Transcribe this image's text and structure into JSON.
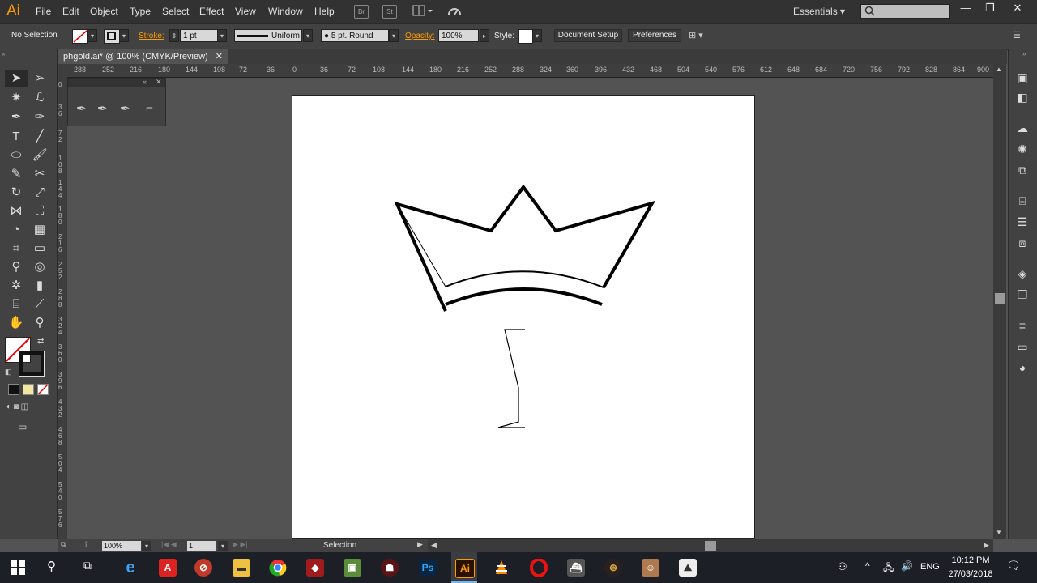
{
  "app": {
    "logo": "Ai",
    "document_tab": "phgold.ai* @ 100% (CMYK/Preview)",
    "workspace": "Essentials"
  },
  "menu": [
    "File",
    "Edit",
    "Object",
    "Type",
    "Select",
    "Effect",
    "View",
    "Window",
    "Help"
  ],
  "menu_icons": [
    "Br",
    "St",
    "arrange-documents-icon",
    "gpu-performance-icon"
  ],
  "control_bar": {
    "selection": "No Selection",
    "stroke_label": "Stroke:",
    "stroke_weight": "1 pt",
    "stroke_profile": "Uniform",
    "brush": "5 pt. Round",
    "opacity_label": "Opacity:",
    "opacity": "100%",
    "style_label": "Style:",
    "document_setup": "Document Setup",
    "preferences": "Preferences"
  },
  "ruler_h": [
    "288",
    "252",
    "216",
    "180",
    "144",
    "108",
    "72",
    "36",
    "0",
    "36",
    "72",
    "108",
    "144",
    "180",
    "216",
    "252",
    "288",
    "324",
    "360",
    "396",
    "432",
    "468",
    "504",
    "540",
    "576",
    "612",
    "648",
    "684",
    "720",
    "756",
    "792",
    "828",
    "864",
    "900"
  ],
  "ruler_v": [
    "0",
    "3 6",
    "7 2",
    "1 0 8",
    "1 4 4",
    "1 8 0",
    "2 1 6",
    "2 5 2",
    "2 8 8",
    "3 2 4",
    "3 6 0",
    "3 9 6",
    "4 3 2",
    "4 6 8",
    "5 0 4",
    "5 4 0",
    "5 7 6"
  ],
  "status": {
    "zoom": "100%",
    "artboard": "1",
    "tool": "Selection"
  },
  "taskbar": {
    "time": "10:12 PM",
    "date": "27/03/2018",
    "language": "ENG",
    "apps": [
      "start-icon",
      "search-icon",
      "task-view-icon",
      "edge-icon",
      "acrobat-icon",
      "app-red-icon",
      "file-explorer-icon",
      "chrome-icon",
      "dota-icon",
      "minecraft-icon",
      "game-icon",
      "photoshop-icon",
      "illustrator-icon",
      "vlc-icon",
      "opera-icon",
      "app-ship-icon",
      "app-circle-icon",
      "app-face-icon",
      "photos-icon"
    ]
  },
  "colors": {
    "accent": "#ff9a00",
    "bg_dark": "#323232",
    "panel": "#424242",
    "workspace": "#535353",
    "artboard": "#ffffff"
  }
}
